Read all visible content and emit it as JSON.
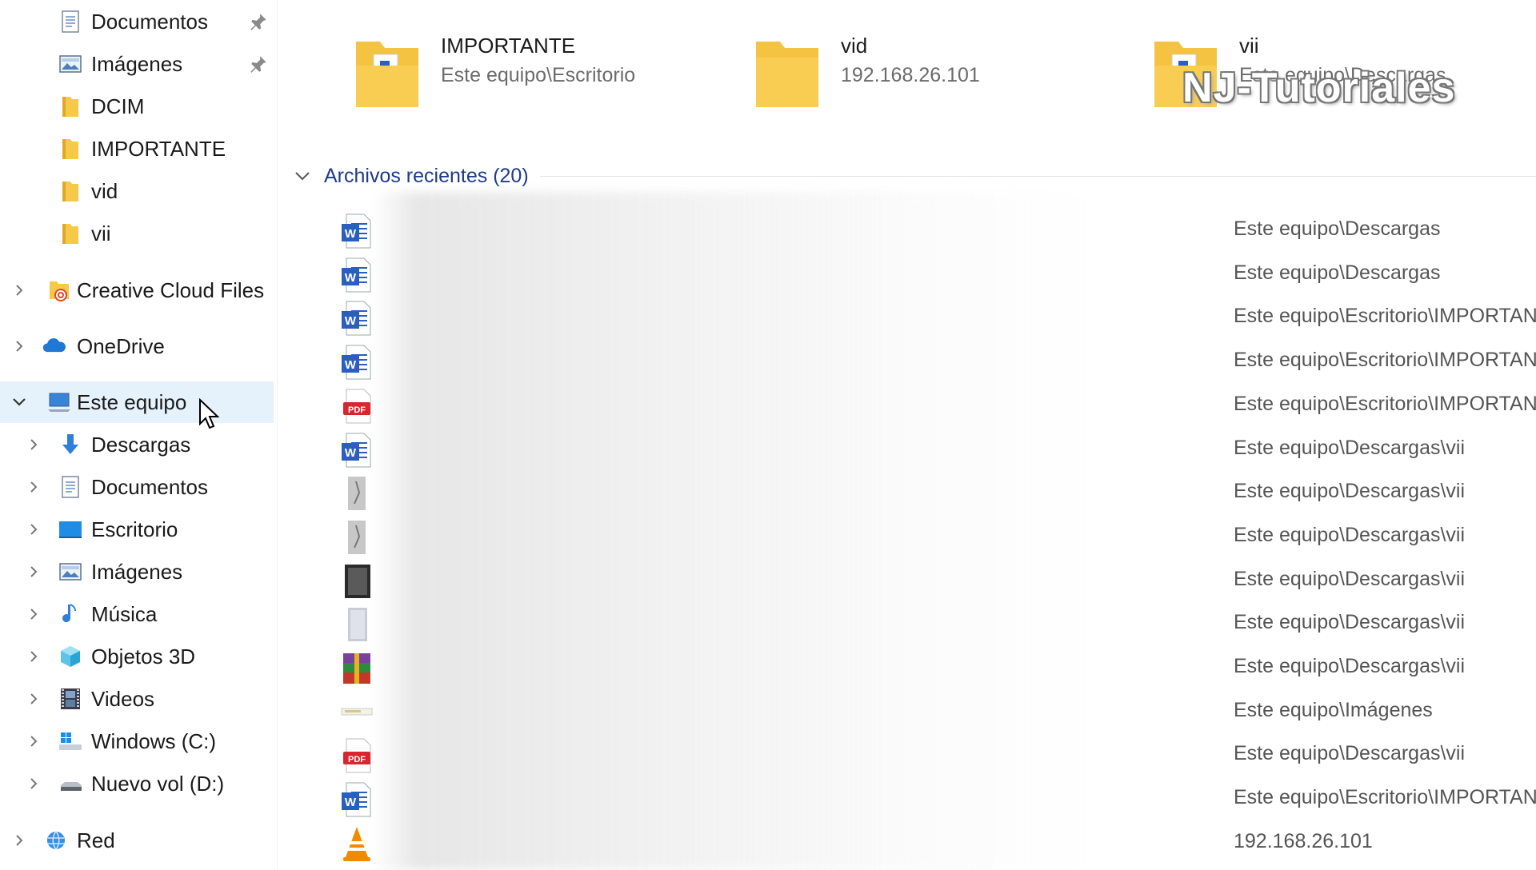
{
  "sidebar": {
    "quick_access": [
      {
        "label": "Documentos",
        "icon": "documents-icon",
        "pinned": true
      },
      {
        "label": "Imágenes",
        "icon": "pictures-icon",
        "pinned": true
      },
      {
        "label": "DCIM",
        "icon": "folder-icon"
      },
      {
        "label": "IMPORTANTE",
        "icon": "folder-icon"
      },
      {
        "label": "vid",
        "icon": "folder-icon"
      },
      {
        "label": "vii",
        "icon": "folder-icon"
      }
    ],
    "creative_cloud": {
      "label": "Creative Cloud Files",
      "icon": "creative-cloud-icon"
    },
    "onedrive": {
      "label": "OneDrive",
      "icon": "cloud-icon"
    },
    "this_pc": {
      "label": "Este equipo",
      "icon": "computer-icon",
      "expanded": true,
      "selected": true
    },
    "this_pc_children": [
      {
        "label": "Descargas",
        "icon": "download-icon"
      },
      {
        "label": "Documentos",
        "icon": "documents-icon"
      },
      {
        "label": "Escritorio",
        "icon": "desktop-icon"
      },
      {
        "label": "Imágenes",
        "icon": "pictures-icon"
      },
      {
        "label": "Música",
        "icon": "music-icon"
      },
      {
        "label": "Objetos 3D",
        "icon": "cube-3d-icon"
      },
      {
        "label": "Videos",
        "icon": "film-icon"
      },
      {
        "label": "Windows (C:)",
        "icon": "windows-drive-icon"
      },
      {
        "label": "Nuevo vol (D:)",
        "icon": "drive-icon"
      }
    ],
    "network": {
      "label": "Red",
      "icon": "network-icon"
    }
  },
  "quick_access_tiles": [
    {
      "name": "IMPORTANTE",
      "path": "Este equipo\\Escritorio",
      "icon": "folder-with-files-icon"
    },
    {
      "name": "vid",
      "path": "192.168.26.101",
      "icon": "folder-icon"
    },
    {
      "name": "vii",
      "path": "Este equipo\\Descargas",
      "icon": "folder-with-files-icon"
    }
  ],
  "recent": {
    "title": "Archivos recientes (20)",
    "files": [
      {
        "type": "word",
        "path": "Este equipo\\Descargas"
      },
      {
        "type": "word",
        "path": "Este equipo\\Descargas"
      },
      {
        "type": "word",
        "path": "Este equipo\\Escritorio\\IMPORTANTE"
      },
      {
        "type": "word",
        "path": "Este equipo\\Escritorio\\IMPORTANTE"
      },
      {
        "type": "pdf",
        "path": "Este equipo\\Escritorio\\IMPORTANTE"
      },
      {
        "type": "word",
        "path": "Este equipo\\Descargas\\vii"
      },
      {
        "type": "image",
        "path": "Este equipo\\Descargas\\vii"
      },
      {
        "type": "image",
        "path": "Este equipo\\Descargas\\vii"
      },
      {
        "type": "image-dark",
        "path": "Este equipo\\Descargas\\vii"
      },
      {
        "type": "image-light",
        "path": "Este equipo\\Descargas\\vii"
      },
      {
        "type": "rar",
        "path": "Este equipo\\Descargas\\vii"
      },
      {
        "type": "generic",
        "path": "Este equipo\\Imágenes"
      },
      {
        "type": "pdf",
        "path": "Este equipo\\Descargas\\vii"
      },
      {
        "type": "word",
        "path": "Este equipo\\Escritorio\\IMPORTANTE"
      },
      {
        "type": "vlc",
        "path": "192.168.26.101"
      }
    ]
  },
  "watermark": "NJ-Tutoriales",
  "colors": {
    "selected_bg": "#e5f1fb",
    "accent": "#1e3a8a",
    "folder": "#f7c948"
  }
}
